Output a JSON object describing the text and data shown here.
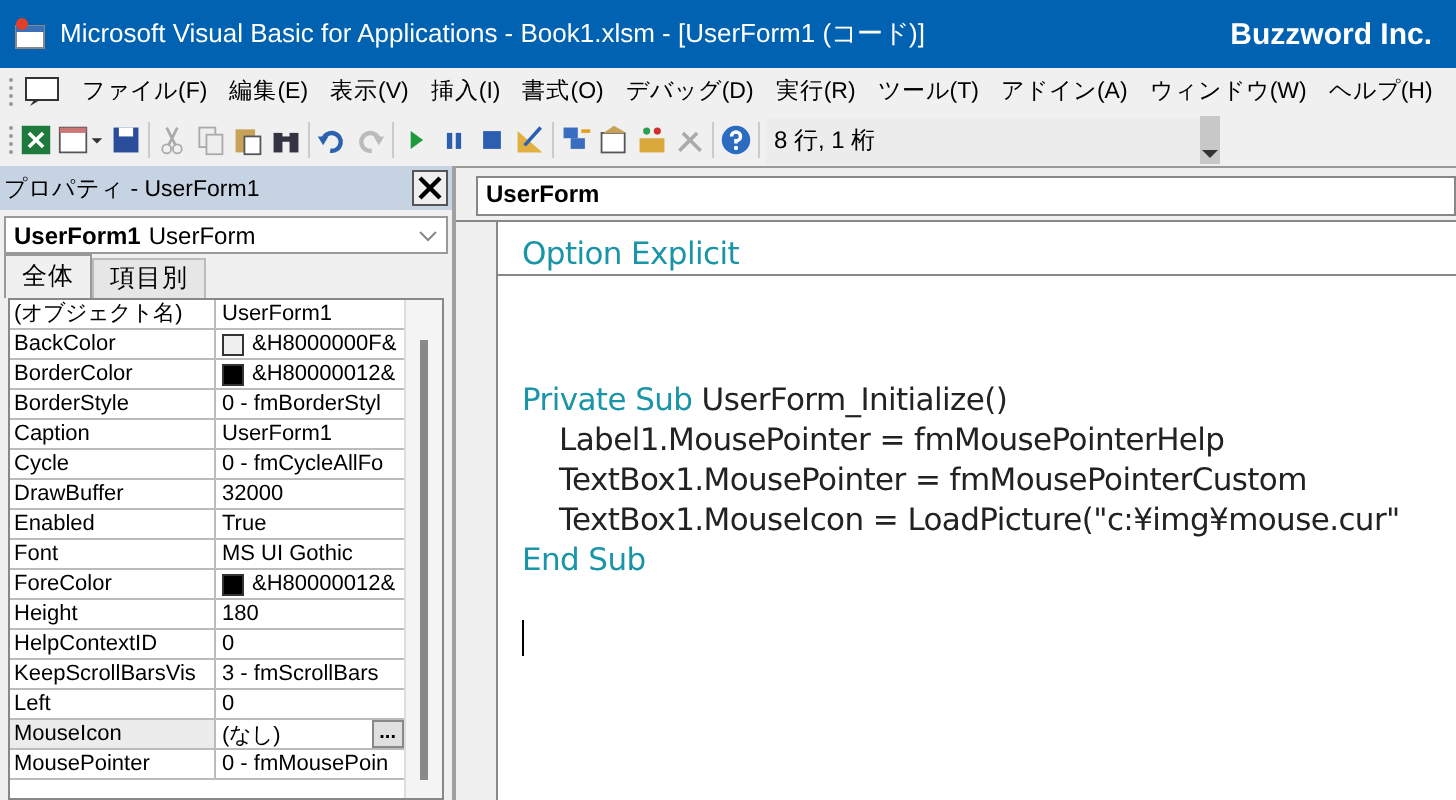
{
  "window": {
    "title": "Microsoft Visual Basic for Applications - Book1.xlsm - [UserForm1 (コード)]",
    "brand": "Buzzword Inc."
  },
  "menu": [
    "ファイル(F)",
    "編集(E)",
    "表示(V)",
    "挿入(I)",
    "書式(O)",
    "デバッグ(D)",
    "実行(R)",
    "ツール(T)",
    "アドイン(A)",
    "ウィンドウ(W)",
    "ヘルプ(H)"
  ],
  "toolbar": {
    "position": "8 行, 1 桁"
  },
  "properties": {
    "title": "プロパティ - UserForm1",
    "object_name": "UserForm1",
    "object_type": "UserForm",
    "tabs": [
      {
        "label": "全体",
        "selected": true
      },
      {
        "label": "項目別",
        "selected": false
      }
    ],
    "rows": [
      {
        "name": "(オブジェクト名)",
        "value": "UserForm1",
        "selected": false
      },
      {
        "name": "BackColor",
        "value": "&H8000000F&",
        "color": "#f0f0f0",
        "selected": false
      },
      {
        "name": "BorderColor",
        "value": "&H80000012&",
        "color": "#000000",
        "selected": false
      },
      {
        "name": "BorderStyle",
        "value": "0 - fmBorderStyl",
        "selected": false
      },
      {
        "name": "Caption",
        "value": "UserForm1",
        "selected": false
      },
      {
        "name": "Cycle",
        "value": "0 - fmCycleAllFo",
        "selected": false
      },
      {
        "name": "DrawBuffer",
        "value": "32000",
        "selected": false
      },
      {
        "name": "Enabled",
        "value": "True",
        "selected": false
      },
      {
        "name": "Font",
        "value": "MS UI Gothic",
        "selected": false
      },
      {
        "name": "ForeColor",
        "value": "&H80000012&",
        "color": "#000000",
        "selected": false
      },
      {
        "name": "Height",
        "value": "180",
        "selected": false
      },
      {
        "name": "HelpContextID",
        "value": "0",
        "selected": false
      },
      {
        "name": "KeepScrollBarsVis",
        "value": "3 - fmScrollBars",
        "selected": false
      },
      {
        "name": "Left",
        "value": "0",
        "selected": false
      },
      {
        "name": "MouseIcon",
        "value": "(なし)",
        "button": "...",
        "selected": true
      },
      {
        "name": "MousePointer",
        "value": "0 - fmMousePoin",
        "selected": false
      }
    ]
  },
  "code": {
    "object": "UserForm",
    "declarations": [
      {
        "kind": "keyword",
        "text": "Option Explicit"
      }
    ],
    "lines": [
      [
        {
          "kind": "keyword",
          "text": "Private Sub "
        },
        {
          "kind": "plain",
          "text": "UserForm_Initialize()"
        }
      ],
      [
        {
          "kind": "plain",
          "text": "    Label1.MousePointer = fmMousePointerHelp"
        }
      ],
      [
        {
          "kind": "plain",
          "text": "    TextBox1.MousePointer = fmMousePointerCustom"
        }
      ],
      [
        {
          "kind": "plain",
          "text": "    TextBox1.MouseIcon = LoadPicture(\"c:¥img¥mouse.cur\""
        }
      ],
      [
        {
          "kind": "keyword",
          "text": "End Sub"
        }
      ]
    ]
  }
}
